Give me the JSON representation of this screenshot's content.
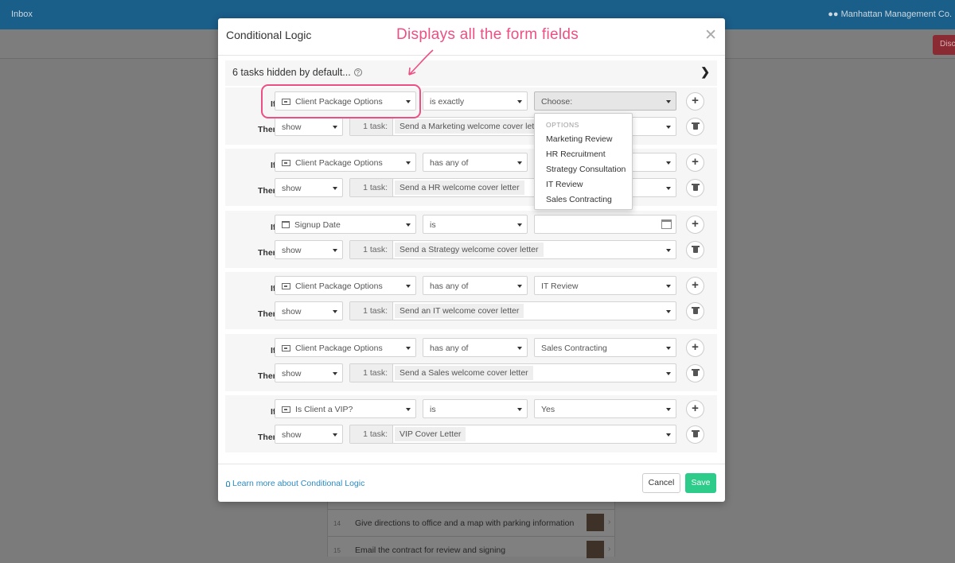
{
  "background": {
    "topbar_left": "Inbox",
    "topbar_right": "Manhattan Management Co.",
    "corner_button": "Disc",
    "list_rows": [
      {
        "num": "14",
        "text": "Give directions to office and a map with parking information"
      },
      {
        "num": "15",
        "text": "Email the contract for review and signing"
      }
    ]
  },
  "annotation": {
    "text": "Displays all the form fields",
    "color": "#ee4f82"
  },
  "modal": {
    "title": "Conditional Logic",
    "close_icon": "close-icon",
    "hidden_bar": {
      "label": "6 tasks hidden by default...",
      "help": "?"
    },
    "if_label": "If",
    "then_label": "Then",
    "rules": [
      {
        "field": "Client Package Options",
        "field_icon": "form-field-icon",
        "operator": "is exactly",
        "value": "Choose:",
        "value_type": "select-active",
        "action": "show",
        "task_count": "1 task:",
        "task": "Send a Marketing welcome cover letter"
      },
      {
        "field": "Client Package Options",
        "field_icon": "form-field-icon",
        "operator": "has any of",
        "value": "",
        "value_type": "select",
        "action": "show",
        "task_count": "1 task:",
        "task": "Send a HR welcome cover letter"
      },
      {
        "field": "Signup Date",
        "field_icon": "calendar-icon",
        "operator": "is",
        "value": "",
        "value_type": "date",
        "action": "show",
        "task_count": "1 task:",
        "task": "Send a Strategy welcome cover letter"
      },
      {
        "field": "Client Package Options",
        "field_icon": "form-field-icon",
        "operator": "has any of",
        "value": "IT Review",
        "value_type": "select",
        "action": "show",
        "task_count": "1 task:",
        "task": "Send an IT welcome cover letter"
      },
      {
        "field": "Client Package Options",
        "field_icon": "form-field-icon",
        "operator": "has any of",
        "value": "Sales Contracting",
        "value_type": "select",
        "action": "show",
        "task_count": "1 task:",
        "task": "Send a Sales welcome cover letter"
      },
      {
        "field": "Is Client a VIP?",
        "field_icon": "form-field-icon",
        "operator": "is",
        "value": "Yes",
        "value_type": "select",
        "action": "show",
        "task_count": "1 task:",
        "task": "VIP Cover Letter"
      }
    ],
    "dropdown": {
      "header": "OPTIONS",
      "options": [
        "Marketing Review",
        "HR Recruitment",
        "Strategy Consultation",
        "IT Review",
        "Sales Contracting"
      ]
    },
    "footer": {
      "learn_link": "Learn more about Conditional Logic",
      "cancel": "Cancel",
      "save": "Save"
    }
  },
  "colors": {
    "accent_save": "#2ecc8a",
    "link": "#2a8bc4",
    "topbar": "#1a5e8a"
  }
}
